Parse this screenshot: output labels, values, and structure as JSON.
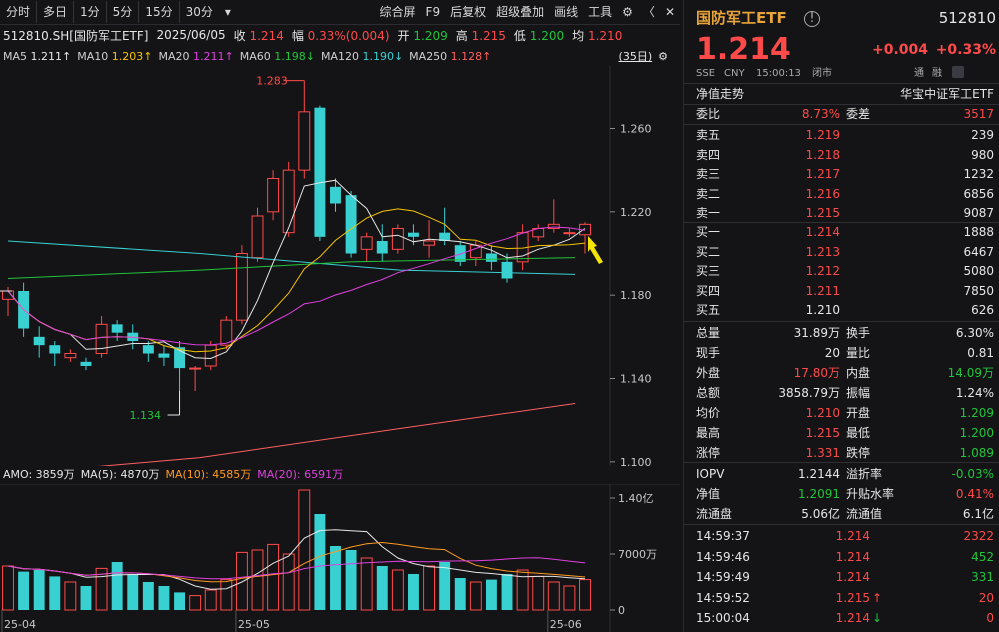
{
  "toolbar": {
    "left": [
      "分时",
      "多日",
      "1分",
      "5分",
      "15分",
      "30分"
    ],
    "right": [
      "综合屏",
      "F9",
      "后复权",
      "超级叠加",
      "画线",
      "工具"
    ]
  },
  "header": {
    "code": "512810.SH[国防军工ETF]",
    "date": "2025/06/05",
    "close_label": "收",
    "close": "1.214",
    "amp_label": "幅",
    "amp": "0.33%(0.004)",
    "open_label": "开",
    "open": "1.209",
    "high_label": "高",
    "high": "1.215",
    "low_label": "低",
    "low": "1.200",
    "avg_label": "均",
    "avg": "1.210"
  },
  "ma": [
    {
      "label": "MA5",
      "value": "1.211↑",
      "color": "#e6e6e6"
    },
    {
      "label": "MA10",
      "value": "1.203↑",
      "color": "#f5c400"
    },
    {
      "label": "MA20",
      "value": "1.211↑",
      "color": "#e040e0"
    },
    {
      "label": "MA60",
      "value": "1.198↓",
      "color": "#21c43b"
    },
    {
      "label": "MA120",
      "value": "1.190↓",
      "color": "#38d0d0"
    },
    {
      "label": "MA250",
      "value": "1.128↑",
      "color": "#ff6060"
    }
  ],
  "days_badge": "(35日)",
  "chart_data": {
    "type": "candlestick",
    "price_axis": [
      "1.260",
      "1.220",
      "1.180",
      "1.140",
      "1.100"
    ],
    "price_range": [
      1.098,
      1.29
    ],
    "high_annotation": "1.283",
    "low_annotation": "1.134",
    "x_labels": [
      "25-04",
      "25-05",
      "25-06"
    ],
    "candles": [
      {
        "o": 1.178,
        "c": 1.182,
        "h": 1.184,
        "l": 1.17
      },
      {
        "o": 1.182,
        "c": 1.164,
        "h": 1.186,
        "l": 1.16
      },
      {
        "o": 1.16,
        "c": 1.156,
        "h": 1.165,
        "l": 1.15
      },
      {
        "o": 1.156,
        "c": 1.152,
        "h": 1.158,
        "l": 1.146
      },
      {
        "o": 1.15,
        "c": 1.152,
        "h": 1.154,
        "l": 1.148
      },
      {
        "o": 1.148,
        "c": 1.146,
        "h": 1.15,
        "l": 1.144
      },
      {
        "o": 1.152,
        "c": 1.166,
        "h": 1.17,
        "l": 1.15
      },
      {
        "o": 1.166,
        "c": 1.162,
        "h": 1.168,
        "l": 1.158
      },
      {
        "o": 1.162,
        "c": 1.158,
        "h": 1.166,
        "l": 1.154
      },
      {
        "o": 1.156,
        "c": 1.152,
        "h": 1.158,
        "l": 1.148
      },
      {
        "o": 1.152,
        "c": 1.15,
        "h": 1.156,
        "l": 1.146
      },
      {
        "o": 1.155,
        "c": 1.145,
        "h": 1.158,
        "l": 1.134
      },
      {
        "o": 1.145,
        "c": 1.145,
        "h": 1.146,
        "l": 1.134
      },
      {
        "o": 1.146,
        "c": 1.156,
        "h": 1.158,
        "l": 1.144
      },
      {
        "o": 1.156,
        "c": 1.168,
        "h": 1.17,
        "l": 1.154
      },
      {
        "o": 1.168,
        "c": 1.2,
        "h": 1.204,
        "l": 1.166
      },
      {
        "o": 1.198,
        "c": 1.218,
        "h": 1.222,
        "l": 1.196
      },
      {
        "o": 1.22,
        "c": 1.236,
        "h": 1.24,
        "l": 1.216
      },
      {
        "o": 1.21,
        "c": 1.24,
        "h": 1.244,
        "l": 1.208
      },
      {
        "o": 1.24,
        "c": 1.268,
        "h": 1.283,
        "l": 1.236
      },
      {
        "o": 1.27,
        "c": 1.208,
        "h": 1.271,
        "l": 1.206
      },
      {
        "o": 1.232,
        "c": 1.224,
        "h": 1.236,
        "l": 1.22
      },
      {
        "o": 1.228,
        "c": 1.2,
        "h": 1.23,
        "l": 1.198
      },
      {
        "o": 1.202,
        "c": 1.208,
        "h": 1.21,
        "l": 1.196
      },
      {
        "o": 1.206,
        "c": 1.2,
        "h": 1.214,
        "l": 1.196
      },
      {
        "o": 1.202,
        "c": 1.212,
        "h": 1.214,
        "l": 1.2
      },
      {
        "o": 1.21,
        "c": 1.208,
        "h": 1.214,
        "l": 1.204
      },
      {
        "o": 1.204,
        "c": 1.206,
        "h": 1.216,
        "l": 1.198
      },
      {
        "o": 1.21,
        "c": 1.206,
        "h": 1.222,
        "l": 1.204
      },
      {
        "o": 1.204,
        "c": 1.196,
        "h": 1.206,
        "l": 1.194
      },
      {
        "o": 1.198,
        "c": 1.204,
        "h": 1.206,
        "l": 1.194
      },
      {
        "o": 1.2,
        "c": 1.196,
        "h": 1.204,
        "l": 1.192
      },
      {
        "o": 1.196,
        "c": 1.188,
        "h": 1.2,
        "l": 1.186
      },
      {
        "o": 1.196,
        "c": 1.21,
        "h": 1.214,
        "l": 1.192
      },
      {
        "o": 1.208,
        "c": 1.212,
        "h": 1.214,
        "l": 1.206
      },
      {
        "o": 1.212,
        "c": 1.214,
        "h": 1.226,
        "l": 1.21
      },
      {
        "o": 1.21,
        "c": 1.21,
        "h": 1.212,
        "l": 1.208
      },
      {
        "o": 1.209,
        "c": 1.214,
        "h": 1.215,
        "l": 1.2
      }
    ],
    "volume_axis": [
      "1.40亿",
      "7000万",
      "0"
    ],
    "volume_max": 1.5,
    "volumes": [
      0.55,
      0.48,
      0.5,
      0.42,
      0.35,
      0.3,
      0.52,
      0.6,
      0.45,
      0.35,
      0.3,
      0.22,
      0.18,
      0.25,
      0.38,
      0.72,
      0.75,
      0.82,
      0.7,
      1.5,
      1.2,
      0.8,
      0.75,
      0.65,
      0.55,
      0.5,
      0.45,
      0.55,
      0.6,
      0.4,
      0.35,
      0.38,
      0.45,
      0.5,
      0.42,
      0.35,
      0.3,
      0.38
    ]
  },
  "amo": {
    "label": "AMO: 3859万",
    "ma5": "MA(5): 4870万",
    "ma10": "MA(10): 4585万",
    "ma20": "MA(20): 6591万"
  },
  "quote": {
    "name": "国防军工ETF",
    "code": "512810",
    "price": "1.214",
    "change": "+0.004",
    "change_pct": "+0.33%",
    "exchange": "SSE",
    "currency": "CNY",
    "time": "15:00:13",
    "status": "闭市",
    "tong": "通",
    "rong": "融",
    "nav_trend": "净值走势",
    "tracked_index": "华宝中证军工ETF",
    "weibi_label": "委比",
    "weibi": "8.73%",
    "weicha_label": "委差",
    "weicha": "3517",
    "asks": [
      {
        "label": "卖五",
        "price": "1.219",
        "vol": "239"
      },
      {
        "label": "卖四",
        "price": "1.218",
        "vol": "980"
      },
      {
        "label": "卖三",
        "price": "1.217",
        "vol": "1232"
      },
      {
        "label": "卖二",
        "price": "1.216",
        "vol": "6856"
      },
      {
        "label": "卖一",
        "price": "1.215",
        "vol": "9087"
      }
    ],
    "bids": [
      {
        "label": "买一",
        "price": "1.214",
        "vol": "1888",
        "color": "#ff4a4a"
      },
      {
        "label": "买二",
        "price": "1.213",
        "vol": "6467",
        "color": "#ff4a4a"
      },
      {
        "label": "买三",
        "price": "1.212",
        "vol": "5080",
        "color": "#ff4a4a"
      },
      {
        "label": "买四",
        "price": "1.211",
        "vol": "7850",
        "color": "#ff4a4a"
      },
      {
        "label": "买五",
        "price": "1.210",
        "vol": "626",
        "color": "#e6e6e6"
      }
    ],
    "stats": [
      {
        "l1": "总量",
        "v1": "31.89万",
        "c1": "#e6e6e6",
        "l2": "换手",
        "v2": "6.30%",
        "c2": "#e6e6e6"
      },
      {
        "l1": "现手",
        "v1": "20",
        "c1": "#e6e6e6",
        "l2": "量比",
        "v2": "0.81",
        "c2": "#e6e6e6"
      },
      {
        "l1": "外盘",
        "v1": "17.80万",
        "c1": "#ff4a4a",
        "l2": "内盘",
        "v2": "14.09万",
        "c2": "#21c43b"
      },
      {
        "l1": "总额",
        "v1": "3858.79万",
        "c1": "#e6e6e6",
        "l2": "振幅",
        "v2": "1.24%",
        "c2": "#e6e6e6"
      },
      {
        "l1": "均价",
        "v1": "1.210",
        "c1": "#ff4a4a",
        "l2": "开盘",
        "v2": "1.209",
        "c2": "#21c43b"
      },
      {
        "l1": "最高",
        "v1": "1.215",
        "c1": "#ff4a4a",
        "l2": "最低",
        "v2": "1.200",
        "c2": "#21c43b"
      },
      {
        "l1": "涨停",
        "v1": "1.331",
        "c1": "#ff4a4a",
        "l2": "跌停",
        "v2": "1.089",
        "c2": "#21c43b"
      }
    ],
    "stats2": [
      {
        "l1": "IOPV",
        "v1": "1.2144",
        "c1": "#e6e6e6",
        "l2": "溢折率",
        "v2": "-0.03%",
        "c2": "#21c43b"
      },
      {
        "l1": "净值",
        "v1": "1.2091",
        "c1": "#21c43b",
        "l2": "升贴水率",
        "v2": "0.41%",
        "c2": "#ff4a4a"
      },
      {
        "l1": "流通盘",
        "v1": "5.06亿",
        "c1": "#e6e6e6",
        "l2": "流通值",
        "v2": "6.1亿",
        "c2": "#e6e6e6"
      }
    ],
    "ticks": [
      {
        "time": "14:59:37",
        "price": "1.214",
        "vol": "2322",
        "vc": "#ff4a4a",
        "arrow": ""
      },
      {
        "time": "14:59:46",
        "price": "1.214",
        "vol": "452",
        "vc": "#21c43b",
        "arrow": ""
      },
      {
        "time": "14:59:49",
        "price": "1.214",
        "vol": "331",
        "vc": "#21c43b",
        "arrow": ""
      },
      {
        "time": "14:59:52",
        "price": "1.215",
        "vol": "20",
        "vc": "#ff4a4a",
        "arrow": "↑"
      },
      {
        "time": "15:00:04",
        "price": "1.214",
        "vol": "0",
        "vc": "#ff4a4a",
        "arrow": "↓"
      }
    ]
  }
}
